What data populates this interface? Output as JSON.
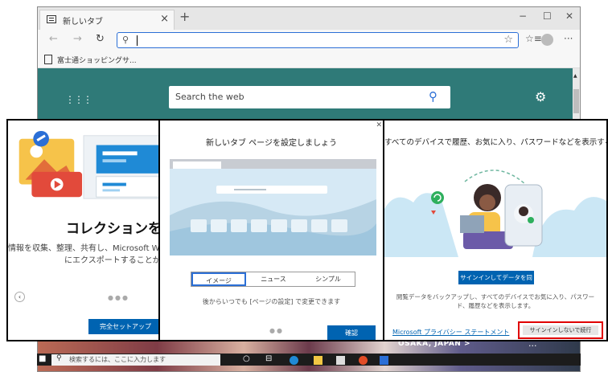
{
  "browser": {
    "tab_title": "新しいタブ",
    "tab_close": "×",
    "new_tab": "+",
    "minimize": "−",
    "maximize": "☐",
    "close": "✕",
    "favorite": "☆",
    "collections": "☆≡",
    "more": "···",
    "fav_item": "富士通ショッピングサ...",
    "search_placeholder": "Search the web",
    "location": "OSAKA, JAPAN >",
    "location_more": "..."
  },
  "taskbar": {
    "search_text": "検索するには、ここに入力します"
  },
  "panel_collections": {
    "heading": "コレクションを試",
    "body_line1": "情報を収集、整理、共有し、Microsoft Wo",
    "body_line2": "にエクスポートすることができま",
    "cta": "完全セットアップ"
  },
  "panel_newtab": {
    "title": "新しいタブ ページを設定しましょう",
    "options": [
      "イメージ",
      "ニュース",
      "シンプル"
    ],
    "selected": "イメージ",
    "note": "後からいつでも [ページの設定] で変更できます",
    "confirm": "確認"
  },
  "panel_sync": {
    "title": "すべてのデバイスで履歴、お気に入り、パスワードなどを表示する",
    "sync_button": "サインインしてデータを同期",
    "description": "閲覧データをバックアップし、すべてのデバイスでお気に入り、パスワード、履歴などを表示します。",
    "privacy_link": "Microsoft プライバシー ステートメント",
    "skip_button": "サインインしないで続行"
  },
  "colors": {
    "accent": "#0063b1",
    "highlight": "#e00000",
    "page_bg": "#2f7a78"
  }
}
